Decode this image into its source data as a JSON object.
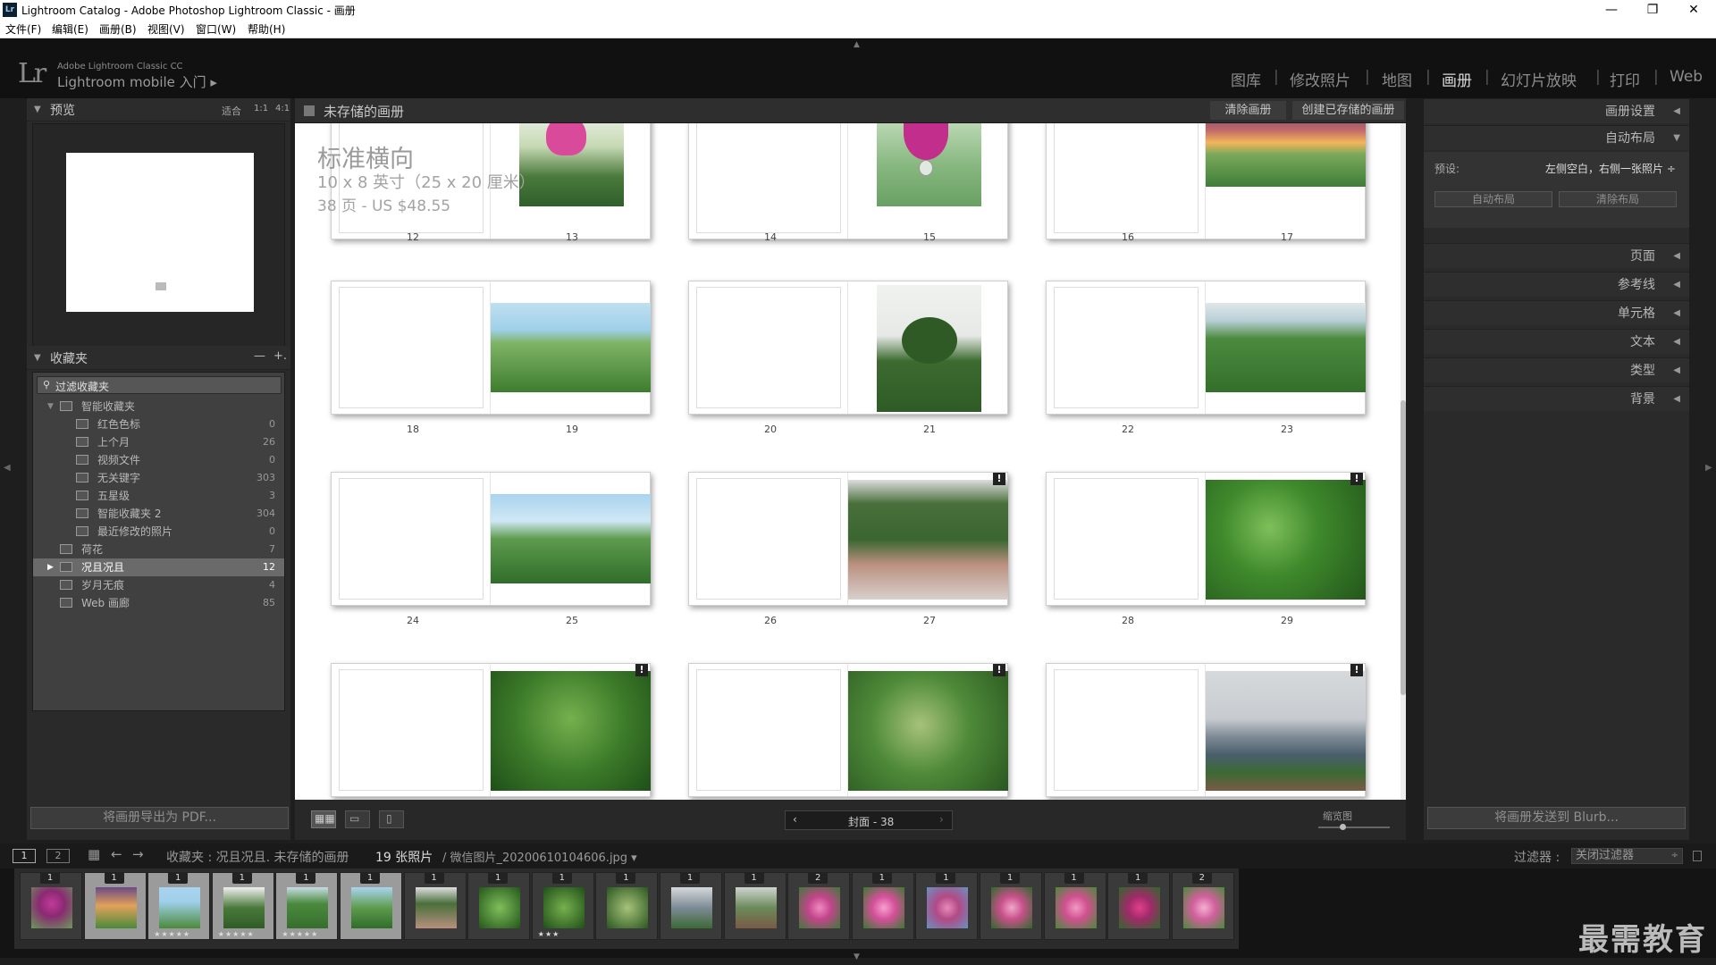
{
  "window": {
    "title": "Lightroom Catalog - Adobe Photoshop Lightroom Classic - 画册",
    "badge": "Lr",
    "minimize": "—",
    "restore": "❐",
    "close": "✕"
  },
  "menu": [
    "文件(F)",
    "编辑(E)",
    "画册(B)",
    "视图(V)",
    "窗口(W)",
    "帮助(H)"
  ],
  "identity": {
    "logo": "Lr",
    "small": "Adobe Lightroom Classic CC",
    "big": "Lightroom mobile 入门 ▸"
  },
  "modules": [
    "图库",
    "修改照片",
    "地图",
    "画册",
    "幻灯片放映",
    "打印",
    "Web"
  ],
  "active_module": "画册",
  "left_panel": {
    "preview": {
      "title": "预览",
      "zoom_options": [
        "适合",
        "1:1",
        "4:1"
      ]
    },
    "collections": {
      "title": "收藏夹",
      "minus": "—",
      "plus": "+.",
      "filter_placeholder": "过滤收藏夹",
      "items": [
        {
          "label": "智能收藏夹",
          "count": "",
          "level": 1,
          "expanded": true
        },
        {
          "label": "红色色标",
          "count": "0",
          "level": 2
        },
        {
          "label": "上个月",
          "count": "26",
          "level": 2
        },
        {
          "label": "视频文件",
          "count": "0",
          "level": 2
        },
        {
          "label": "无关键字",
          "count": "303",
          "level": 2
        },
        {
          "label": "五星级",
          "count": "3",
          "level": 2
        },
        {
          "label": "智能收藏夹 2",
          "count": "304",
          "level": 2
        },
        {
          "label": "最近修改的照片",
          "count": "0",
          "level": 2
        },
        {
          "label": "荷花",
          "count": "7",
          "level": 1
        },
        {
          "label": "况且况且",
          "count": "12",
          "level": 1,
          "selected": true
        },
        {
          "label": "岁月无痕",
          "count": "4",
          "level": 1
        },
        {
          "label": "Web 画廊",
          "count": "85",
          "level": 1
        }
      ]
    },
    "export_button": "将画册导出为 PDF..."
  },
  "center": {
    "title": "未存储的画册",
    "clear_button": "清除画册",
    "create_button": "创建已存储的画册",
    "book_name": "标准横向",
    "book_size": "10 x 8 英寸（25 x 20 厘米）",
    "book_price": "38 页 - US $48.55",
    "page_nav_label": "封面 - 38",
    "thumb_label": "缩览图",
    "spreads": [
      {
        "left": "12",
        "right": "13"
      },
      {
        "left": "14",
        "right": "15"
      },
      {
        "left": "16",
        "right": "17"
      },
      {
        "left": "18",
        "right": "19"
      },
      {
        "left": "20",
        "right": "21"
      },
      {
        "left": "22",
        "right": "23"
      },
      {
        "left": "24",
        "right": "25"
      },
      {
        "left": "26",
        "right": "27"
      },
      {
        "left": "28",
        "right": "29"
      },
      {
        "left": "",
        "right": ""
      },
      {
        "left": "",
        "right": ""
      },
      {
        "left": "",
        "right": ""
      }
    ]
  },
  "right_panel": {
    "sections": [
      "画册设置",
      "自动布局",
      "页面",
      "参考线",
      "单元格",
      "文本",
      "类型",
      "背景"
    ],
    "preset_label": "预设:",
    "preset_value": "左侧空白，右侧一张照片 ÷",
    "auto_layout_button": "自动布局",
    "clear_layout_button": "清除布局",
    "send_button": "将画册发送到 Blurb..."
  },
  "filmstrip_bar": {
    "screen1": "1",
    "screen2": "2",
    "path": "收藏夹 : 况且况且. 未存储的画册",
    "count": "19 张照片",
    "file": "/ 微信图片_20200610104606.jpg ▾",
    "filter_label": "过滤器 :",
    "filter_value": "关闭过滤器"
  },
  "filmstrip": [
    {
      "badge": "1",
      "stars": ""
    },
    {
      "badge": "1",
      "stars": ""
    },
    {
      "badge": "1",
      "stars": "★★★★★"
    },
    {
      "badge": "1",
      "stars": "★★★★★"
    },
    {
      "badge": "1",
      "stars": "★★★★★"
    },
    {
      "badge": "1",
      "stars": ""
    },
    {
      "badge": "1",
      "stars": ""
    },
    {
      "badge": "1",
      "stars": ""
    },
    {
      "badge": "1",
      "stars": "★★★"
    },
    {
      "badge": "1",
      "stars": ""
    },
    {
      "badge": "1",
      "stars": ""
    },
    {
      "badge": "1",
      "stars": ""
    },
    {
      "badge": "2",
      "stars": ""
    },
    {
      "badge": "1",
      "stars": ""
    },
    {
      "badge": "1",
      "stars": ""
    },
    {
      "badge": "1",
      "stars": ""
    },
    {
      "badge": "1",
      "stars": ""
    },
    {
      "badge": "1",
      "stars": ""
    },
    {
      "badge": "2",
      "stars": ""
    }
  ],
  "watermark": "最需教育"
}
